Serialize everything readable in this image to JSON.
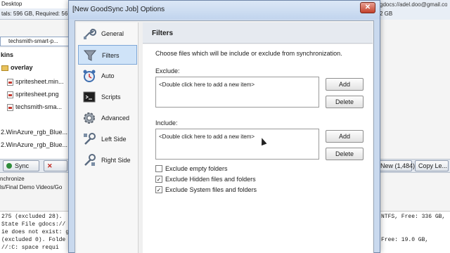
{
  "background": {
    "desktop_label": "Desktop",
    "totals_text": "tals: 596 GB, Required: 56",
    "right_link_text": "gdocs://adel.doo@gmail.com/Tanidg Demo's",
    "right_gb_text": "2 GB",
    "path_text": "techsmith-smart-p...",
    "tree": [
      {
        "label": "kins",
        "bold": true,
        "icon": "none"
      },
      {
        "label": "overlay",
        "bold": true,
        "icon": "folder-icon"
      },
      {
        "label": "spritesheet.min...",
        "bold": false,
        "icon": "file-icon"
      },
      {
        "label": "spritesheet.png",
        "bold": false,
        "icon": "file-icon"
      },
      {
        "label": "techsmith-sma...",
        "bold": false,
        "icon": "file-icon"
      },
      {
        "label": "2.WinAzure_rgb_Blue...",
        "bold": false,
        "icon": "none"
      },
      {
        "label": "2.WinAzure_rgb_Blue...",
        "bold": false,
        "icon": "none"
      }
    ],
    "toolbar": {
      "sync_label": "Sync",
      "stop_label": "✕",
      "new_label": "New (1,484)",
      "copy_label": "Copy Le..."
    },
    "sync_label": "nchronize",
    "sync_path": "ls/Final Demo Videos/Go",
    "log_left": [
      "275 (excluded 28).",
      "State File gdocs://",
      "ie does not exist: g",
      "(excluded 0). Folde",
      "//:C: space requi"
    ],
    "log_right": [
      "NTFS, Free: 336 GB,",
      "",
      "",
      "Free: 19.0 GB,",
      ""
    ]
  },
  "dialog": {
    "title": "[New GoodSync Job] Options",
    "close_label": "✕",
    "nav": [
      {
        "label": "General",
        "icon": "wrench-icon",
        "selected": false
      },
      {
        "label": "Filters",
        "icon": "funnel-icon",
        "selected": true
      },
      {
        "label": "Auto",
        "icon": "alarm-clock-icon",
        "selected": false
      },
      {
        "label": "Scripts",
        "icon": "terminal-icon",
        "selected": false
      },
      {
        "label": "Advanced",
        "icon": "gear-icon",
        "selected": false
      },
      {
        "label": "Left Side",
        "icon": "wrench-left-icon",
        "selected": false
      },
      {
        "label": "Right Side",
        "icon": "wrench-right-icon",
        "selected": false
      }
    ],
    "panel": {
      "title": "Filters",
      "description": "Choose files which will be include or exclude from synchronization.",
      "exclude_label": "Exclude:",
      "exclude_hint": "<Double click here to add a new item>",
      "include_label": "Include:",
      "include_hint": "<Double click here to add a new item>",
      "add_label": "Add",
      "delete_label": "Delete",
      "checks": [
        {
          "label": "Exclude empty folders",
          "checked": false
        },
        {
          "label": "Exclude Hidden files and folders",
          "checked": true
        },
        {
          "label": "Exclude System files and folders",
          "checked": true
        }
      ]
    },
    "colors": {
      "selected_bg": "#cfe3f8",
      "selected_border": "#7ea6d6",
      "close_red": "#c4412c"
    }
  }
}
